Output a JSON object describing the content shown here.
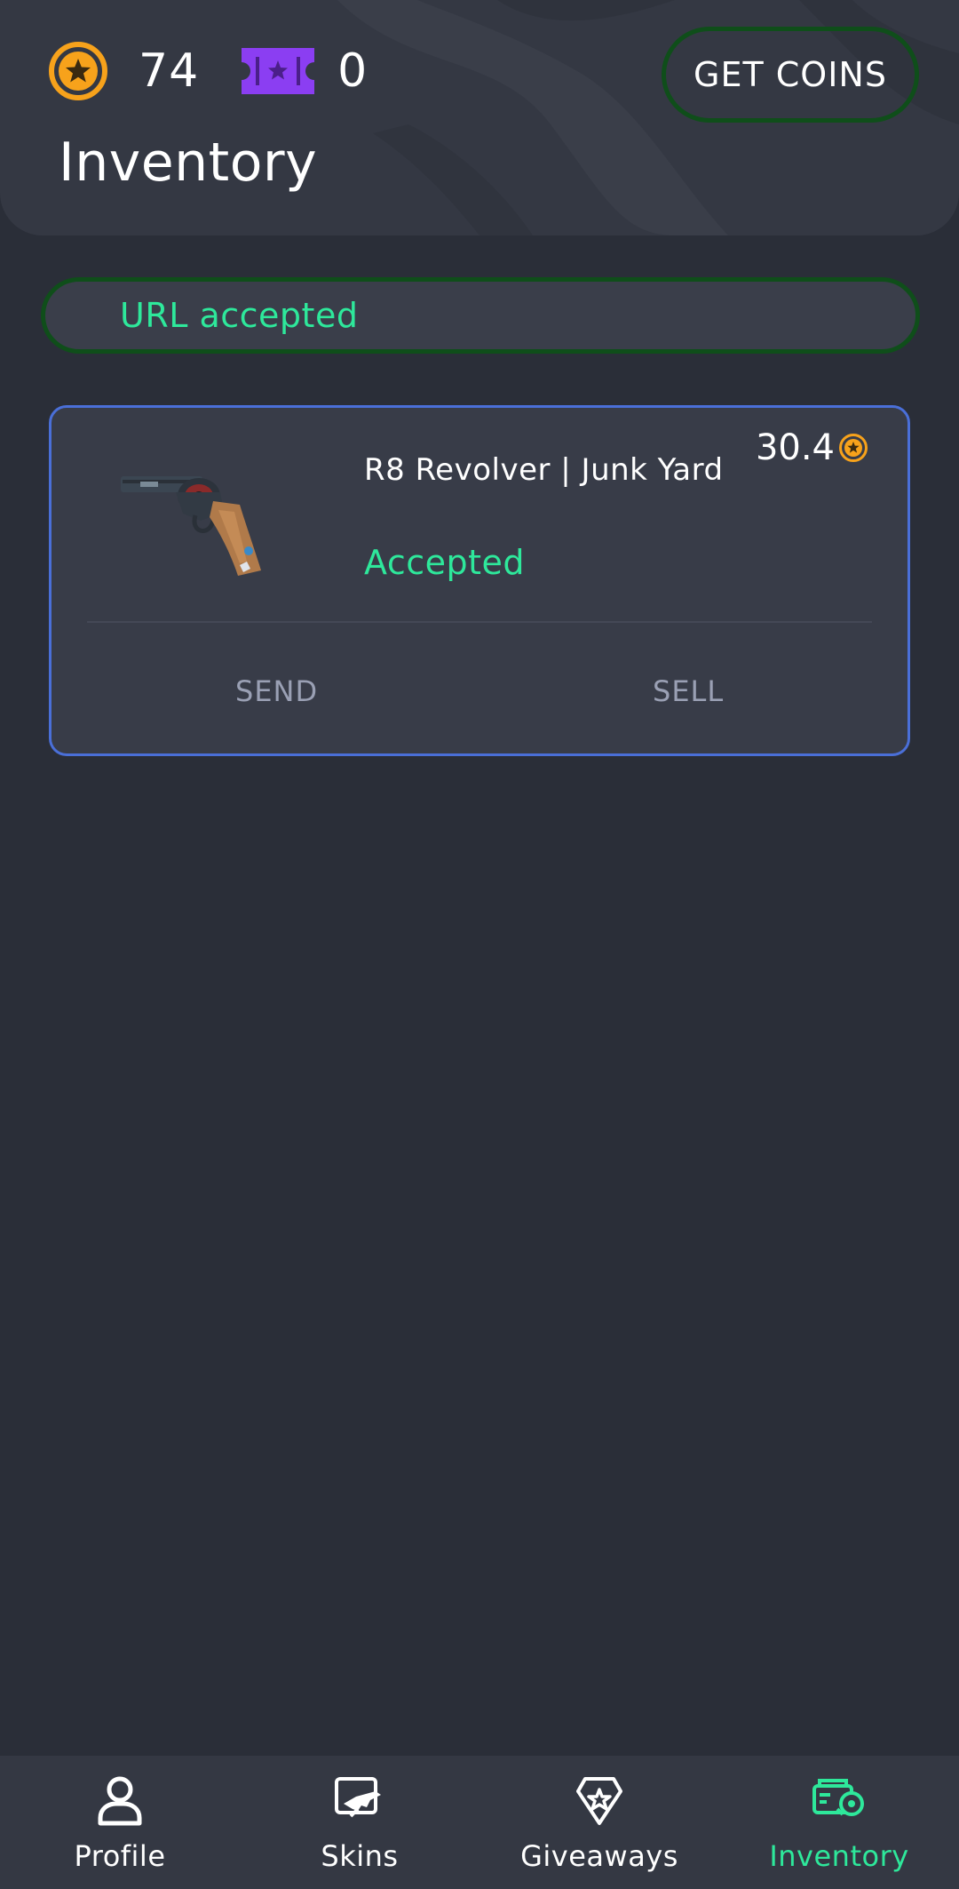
{
  "header": {
    "coins": "74",
    "tickets": "0",
    "get_coins_label": "GET COINS",
    "title": "Inventory"
  },
  "status_banner": {
    "text": "URL accepted",
    "color": "#2ee89b"
  },
  "inventory": {
    "items": [
      {
        "name": "R8 Revolver  |  Junk Yard",
        "status": "Accepted",
        "price": "30.4",
        "actions": {
          "send": "SEND",
          "sell": "SELL"
        }
      }
    ]
  },
  "nav": {
    "items": [
      {
        "label": "Profile",
        "icon": "profile-icon",
        "active": false
      },
      {
        "label": "Skins",
        "icon": "skins-icon",
        "active": false
      },
      {
        "label": "Giveaways",
        "icon": "giveaways-icon",
        "active": false
      },
      {
        "label": "Inventory",
        "icon": "inventory-icon",
        "active": true
      }
    ]
  },
  "colors": {
    "accent": "#2ee89b",
    "coin": "#f7a21b",
    "ticket": "#8b3ef2",
    "card_border": "#4a6fd8",
    "pill_border": "#0f4e1a"
  }
}
